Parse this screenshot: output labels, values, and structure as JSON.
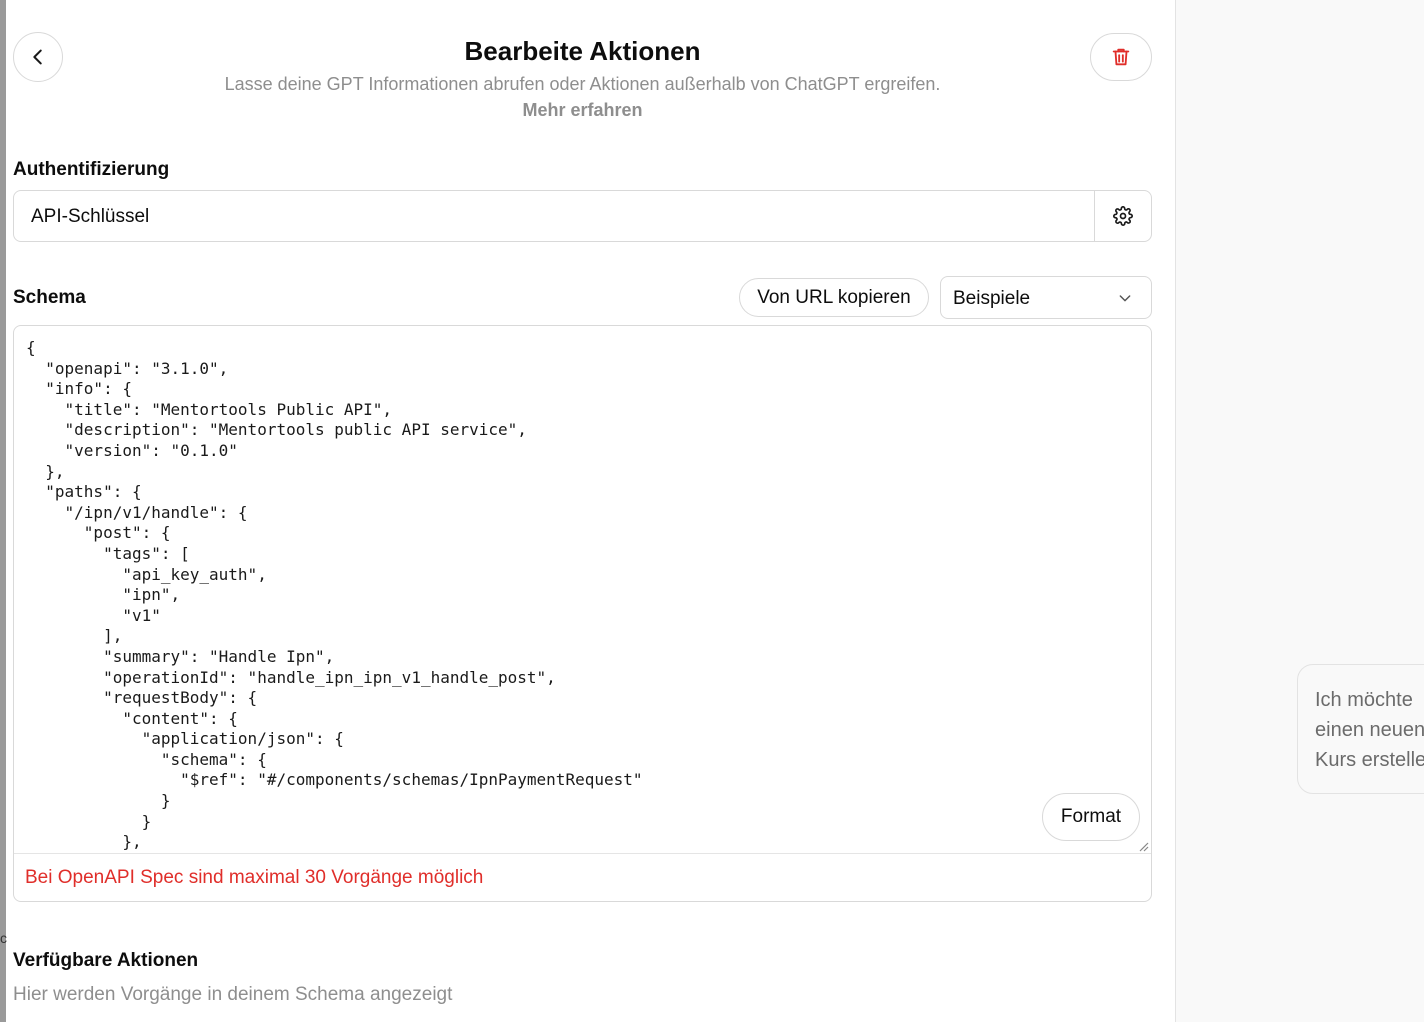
{
  "header": {
    "title": "Bearbeite Aktionen",
    "subtitle": "Lasse deine GPT Informationen abrufen oder Aktionen außerhalb von ChatGPT ergreifen.",
    "learn_more": "Mehr erfahren"
  },
  "icons": {
    "back": "chevron-left-icon",
    "delete": "trash-icon",
    "settings": "gear-icon",
    "dropdown": "chevron-down-icon"
  },
  "colors": {
    "danger": "#e02e2a",
    "muted_text": "#8e8e8e",
    "border": "#d9d9d9"
  },
  "authentication": {
    "label": "Authentifizierung",
    "value": "API-Schlüssel"
  },
  "schema": {
    "label": "Schema",
    "import_url_button": "Von URL kopieren",
    "examples_select": "Beispiele",
    "format_button": "Format",
    "error": "Bei OpenAPI Spec sind maximal 30 Vorgänge möglich",
    "lines": [
      "{",
      "  \"openapi\": \"3.1.0\",",
      "  \"info\": {",
      "    \"title\": \"Mentortools Public API\",",
      "    \"description\": \"Mentortools public API service\",",
      "    \"version\": \"0.1.0\"",
      "  },",
      "  \"paths\": {",
      "    \"/ipn/v1/handle\": {",
      "      \"post\": {",
      "        \"tags\": [",
      "          \"api_key_auth\",",
      "          \"ipn\",",
      "          \"v1\"",
      "        ],",
      "        \"summary\": \"Handle Ipn\",",
      "        \"operationId\": \"handle_ipn_ipn_v1_handle_post\",",
      "        \"requestBody\": {",
      "          \"content\": {",
      "            \"application/json\": {",
      "              \"schema\": {",
      "                \"$ref\": \"#/components/schemas/IpnPaymentRequest\"",
      "              }",
      "            }",
      "          },"
    ]
  },
  "available_actions": {
    "label": "Verfügbare Aktionen",
    "hint": "Hier werden Vorgänge in deinem Schema angezeigt"
  },
  "sidebar": {
    "left_mark": "c",
    "suggestion_lines": [
      "Ich möchte",
      "einen neuen",
      "Kurs erstellen"
    ]
  }
}
